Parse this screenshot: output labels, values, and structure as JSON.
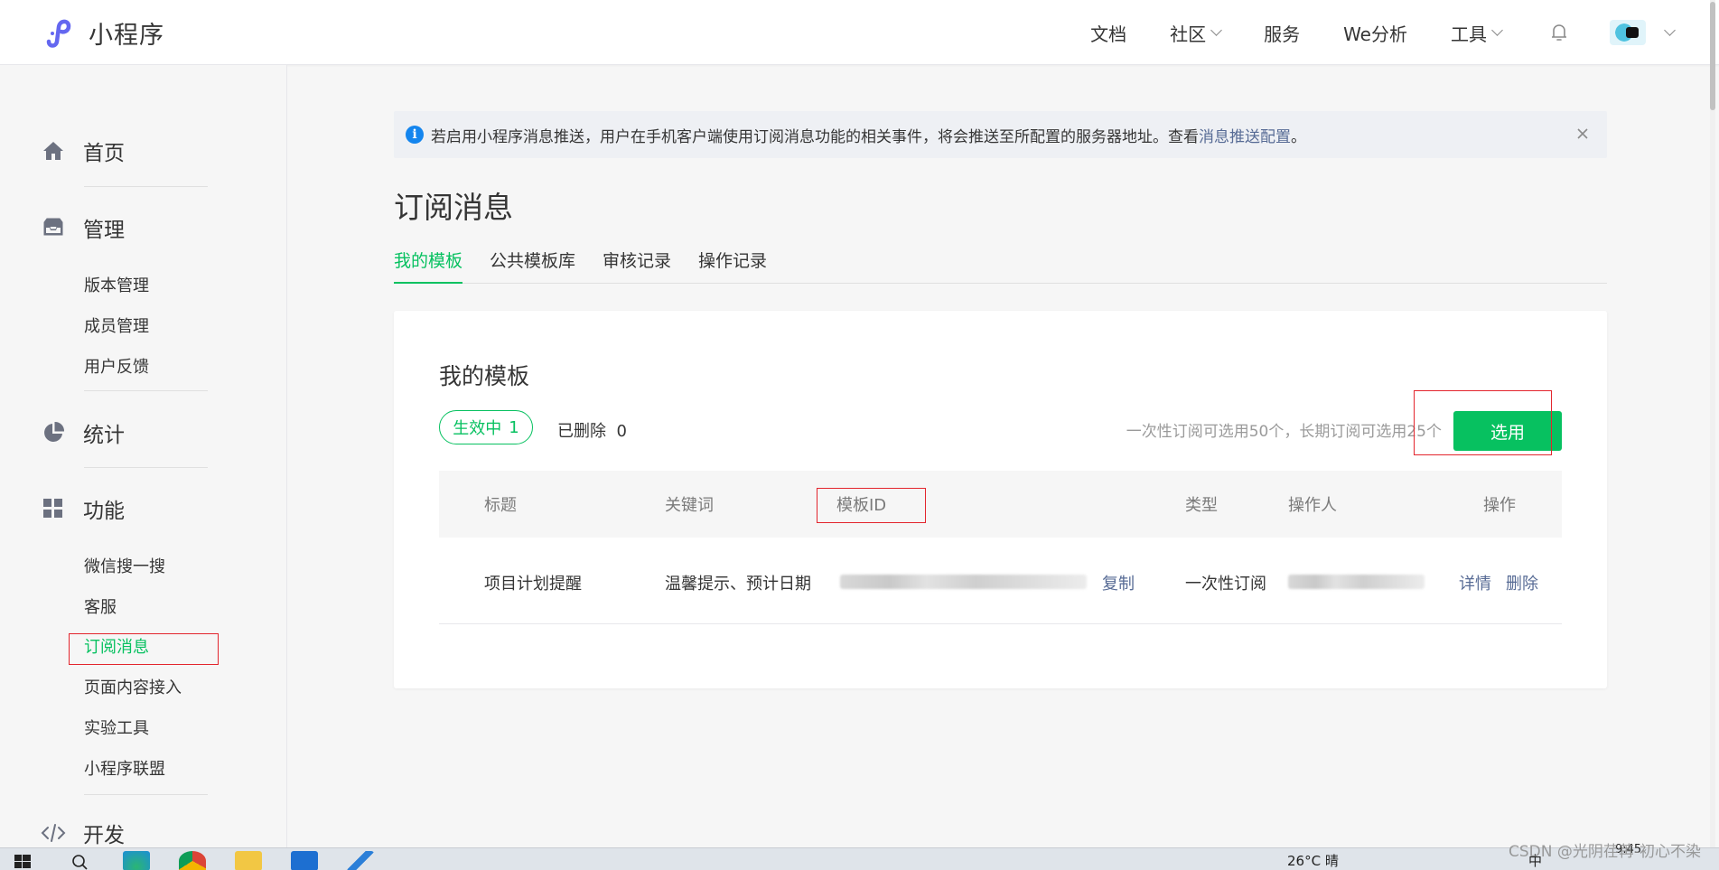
{
  "header": {
    "app_title": "小程序",
    "nav": [
      {
        "label": "文档",
        "dropdown": false
      },
      {
        "label": "社区",
        "dropdown": true
      },
      {
        "label": "服务",
        "dropdown": false
      },
      {
        "label": "We分析",
        "dropdown": false
      },
      {
        "label": "工具",
        "dropdown": true
      }
    ]
  },
  "sidebar": {
    "groups": [
      {
        "label": "首页",
        "icon": "home-icon"
      },
      {
        "label": "管理",
        "icon": "inbox-icon",
        "items": [
          "版本管理",
          "成员管理",
          "用户反馈"
        ]
      },
      {
        "label": "统计",
        "icon": "pie-chart-icon"
      },
      {
        "label": "功能",
        "icon": "grid-icon",
        "items": [
          "微信搜一搜",
          "客服",
          "订阅消息",
          "页面内容接入",
          "实验工具",
          "小程序联盟"
        ]
      },
      {
        "label": "开发",
        "icon": "code-icon"
      }
    ],
    "active_item": "订阅消息"
  },
  "notice": {
    "text": "若启用小程序消息推送，用户在手机客户端使用订阅消息功能的相关事件，将会推送至所配置的服务器地址。查看 ",
    "link": "消息推送配置",
    "end": "。"
  },
  "page": {
    "title": "订阅消息",
    "tabs": [
      "我的模板",
      "公共模板库",
      "审核记录",
      "操作记录"
    ],
    "active_tab": "我的模板"
  },
  "card": {
    "title": "我的模板",
    "active_label": "生效中",
    "active_count": "1",
    "deleted_label": "已删除",
    "deleted_count": "0",
    "quota_text": "一次性订阅可选用50个，长期订阅可选用25个",
    "choose_button": "选用",
    "table": {
      "columns": [
        "标题",
        "关键词",
        "模板ID",
        "类型",
        "操作人",
        "操作"
      ],
      "rows": [
        {
          "title": "项目计划提醒",
          "keywords": "温馨提示、预计日期",
          "copy": "复制",
          "type": "一次性订阅",
          "actions": [
            "详情",
            "删除"
          ]
        }
      ]
    }
  },
  "taskbar": {
    "weather": "26°C 晴",
    "ime": "中",
    "time": "9:45"
  },
  "watermark": "CSDN @光阴荏苒-初心不染",
  "colors": {
    "accent": "#07c160",
    "link": "#576b95",
    "highlight": "#e3252d"
  }
}
